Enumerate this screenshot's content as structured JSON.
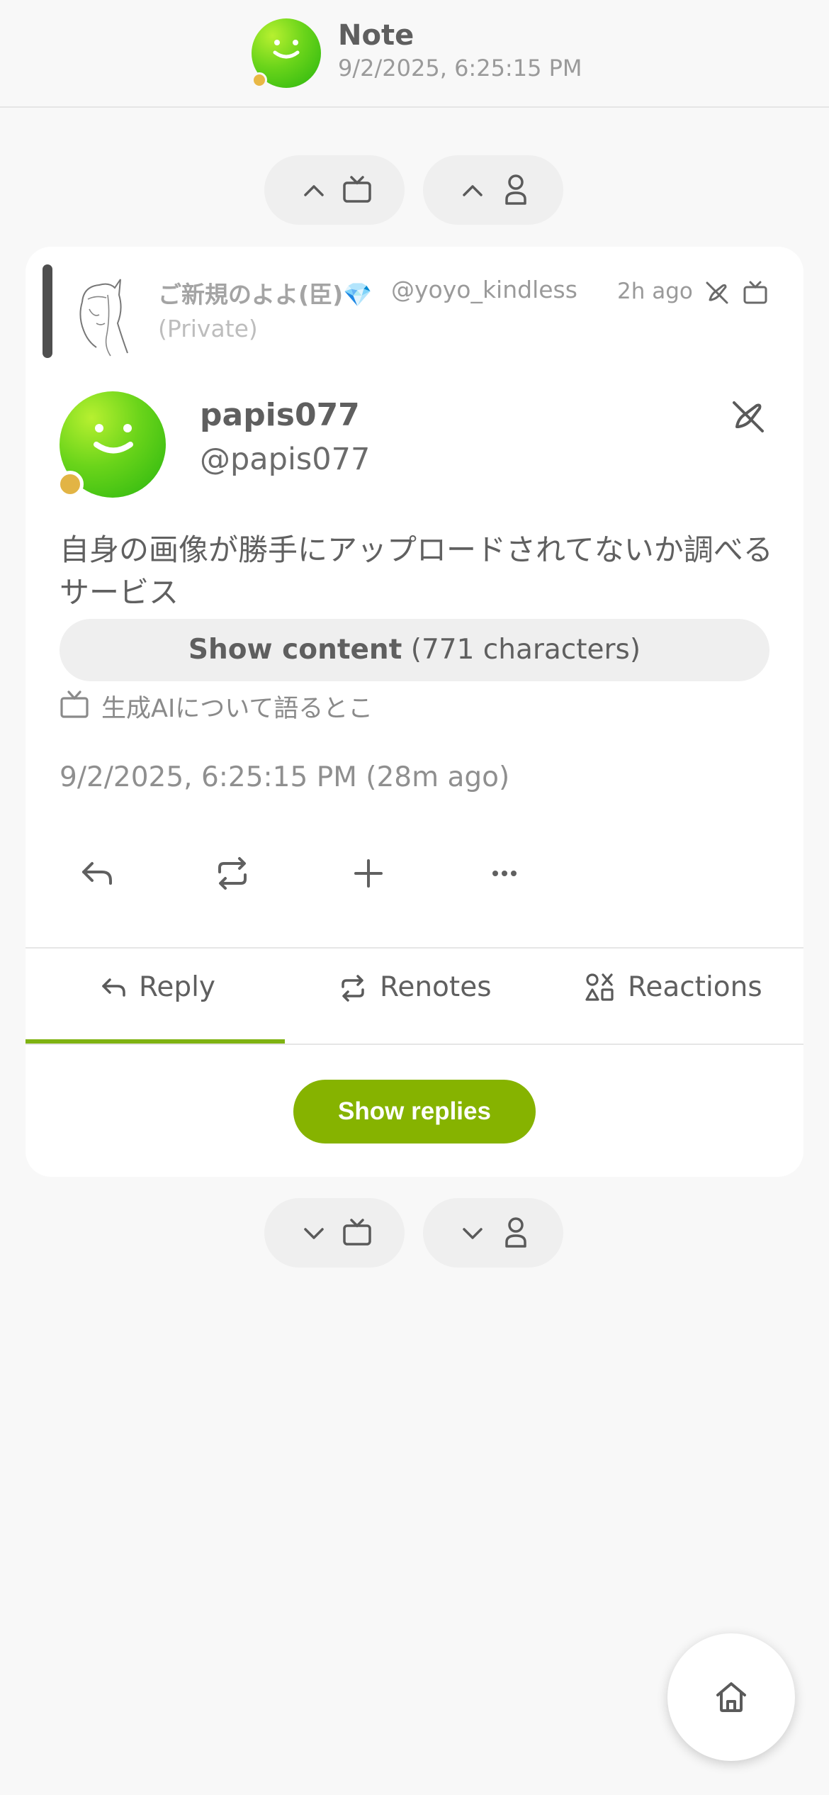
{
  "header": {
    "title": "Note",
    "subtitle": "9/2/2025, 6:25:15 PM"
  },
  "nav": {
    "top_prev_channel_icon": "chevron-up-tv-icon",
    "top_prev_user_icon": "chevron-up-user-icon",
    "bottom_next_channel_icon": "chevron-down-tv-icon",
    "bottom_next_user_icon": "chevron-down-user-icon"
  },
  "renote": {
    "author_name": "ご新規のよよ(臣)💎",
    "author_handle": "@yoyo_kindless",
    "visibility": "(Private)",
    "time": "2h ago"
  },
  "note": {
    "author_name": "papis077",
    "author_handle": "@papis077",
    "cw_text": "自身の画像が勝手にアップロードされてないか調べるサービス",
    "show_content_bold": "Show content",
    "show_content_count": "(771 characters)",
    "channel": "生成AIについて語るとこ",
    "datetime": "9/2/2025, 6:25:15 PM (28m ago)"
  },
  "tabs": [
    {
      "label": "Reply",
      "active": true
    },
    {
      "label": "Renotes",
      "active": false
    },
    {
      "label": "Reactions",
      "active": false
    }
  ],
  "show_replies_label": "Show replies",
  "colors": {
    "accent": "#86b300",
    "background": "#f8f8f8",
    "card": "#ffffff",
    "text": "#5f5f5f",
    "online_dot": "#e2b445"
  }
}
